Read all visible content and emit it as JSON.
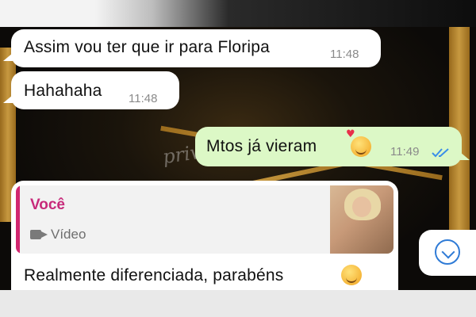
{
  "conversation": {
    "messages": [
      {
        "direction": "incoming",
        "text": "Assim vou ter que ir para Floripa",
        "time": "11:48"
      },
      {
        "direction": "incoming",
        "text": "Hahahaha",
        "time": "11:48"
      },
      {
        "direction": "outgoing",
        "text": "Mtos já vieram",
        "emoji": "smiling-face-with-hearts",
        "time": "11:49",
        "status": "read",
        "status_icon": "double-check-blue"
      },
      {
        "direction": "incoming",
        "reply_to": {
          "sender": "Você",
          "media_type_label": "Vídeo",
          "icon": "video-camera-icon"
        },
        "text": "Realmente diferenciada,  parabéns",
        "emoji": "drooling-face"
      }
    ],
    "watermark": "privé",
    "scroll_button": {
      "icon": "chevron-down-icon"
    }
  },
  "colors": {
    "incoming_bubble": "#ffffff",
    "outgoing_bubble": "#dcf8c6",
    "reply_accent": "#d1266f",
    "read_check": "#3b8ee8",
    "timestamp": "#8a8a8a"
  }
}
